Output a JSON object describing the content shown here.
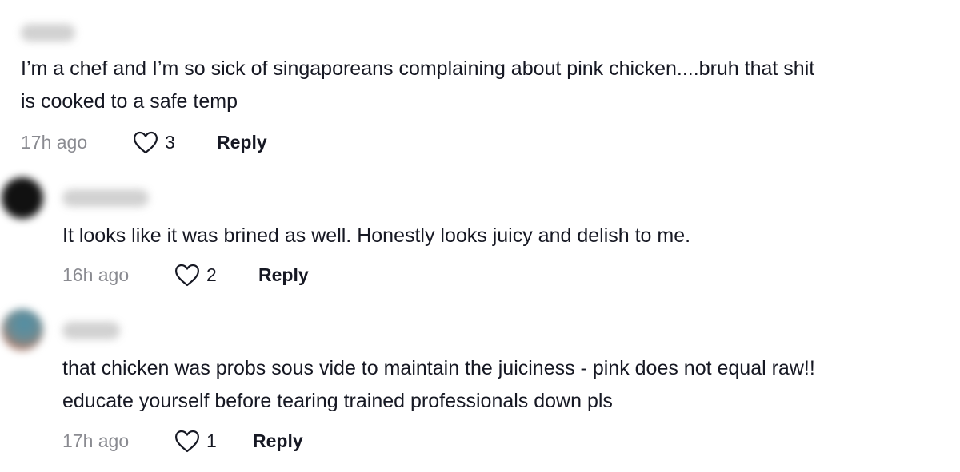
{
  "comments": [
    {
      "text_lines": [
        "I’m a chef and I’m so sick of singaporeans complaining about pink chicken....bruh that shit",
        "is cooked to a safe temp"
      ],
      "time": "17h ago",
      "likes": "3",
      "reply_label": "Reply"
    },
    {
      "text_lines": [
        "It looks like it was brined as well. Honestly looks juicy and delish to me."
      ],
      "time": "16h ago",
      "likes": "2",
      "reply_label": "Reply"
    },
    {
      "text_lines": [
        "that chicken was probs sous vide to maintain the juiciness - pink does not equal raw!!",
        "educate yourself before tearing trained professionals down pls"
      ],
      "time": "17h ago",
      "likes": "1",
      "reply_label": "Reply"
    }
  ],
  "colors": {
    "text": "#161823",
    "timestamp": "#8a8b91",
    "avatar_2": "#111111",
    "avatar_3": "#6a8a94"
  },
  "icons": {
    "like": "heart-outline-icon"
  }
}
